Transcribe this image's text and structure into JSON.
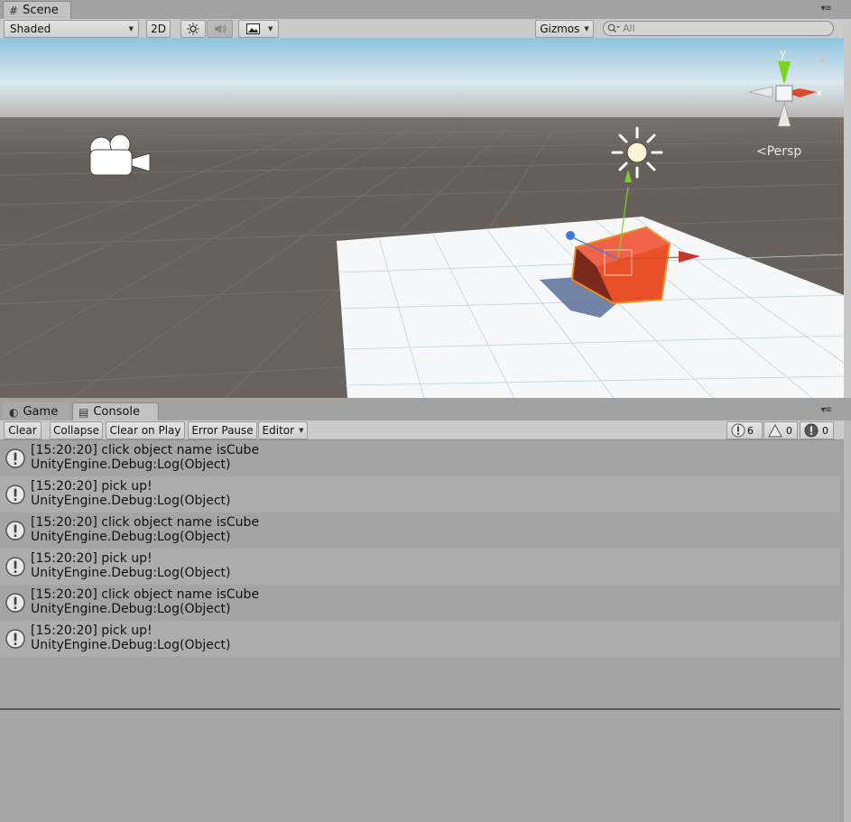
{
  "scene_panel": {
    "tab_label": "Scene",
    "toolbar": {
      "shading_mode": "Shaded",
      "mode_2d": "2D",
      "gizmos_label": "Gizmos",
      "search_placeholder": "All"
    },
    "gizmo_axes": {
      "y": "y",
      "x": "x"
    },
    "projection_label": "Persp"
  },
  "console_panel": {
    "tabs": [
      {
        "label": "Game"
      },
      {
        "label": "Console"
      }
    ],
    "toolbar": {
      "clear": "Clear",
      "collapse": "Collapse",
      "clear_on_play": "Clear on Play",
      "error_pause": "Error Pause",
      "editor": "Editor"
    },
    "counts": {
      "logs": "6",
      "warnings": "0",
      "errors": "0"
    },
    "messages": [
      {
        "line1": "[15:20:20] click object name isCube",
        "line2": "UnityEngine.Debug:Log(Object)"
      },
      {
        "line1": "[15:20:20] pick up!",
        "line2": "UnityEngine.Debug:Log(Object)"
      },
      {
        "line1": "[15:20:20] click object name isCube",
        "line2": "UnityEngine.Debug:Log(Object)"
      },
      {
        "line1": "[15:20:20] pick up!",
        "line2": "UnityEngine.Debug:Log(Object)"
      },
      {
        "line1": "[15:20:20] click object name isCube",
        "line2": "UnityEngine.Debug:Log(Object)"
      },
      {
        "line1": "[15:20:20] pick up!",
        "line2": "UnityEngine.Debug:Log(Object)"
      }
    ]
  },
  "colors": {
    "sky": "#b8d8e8",
    "ground": "#635c57",
    "plane": "#ffffff",
    "cube": "#e8502a",
    "selection_outline": "#f08a1c",
    "axis_y": "#7ed321",
    "axis_x": "#e04a2a",
    "axis_z": "#3a7ae0"
  }
}
